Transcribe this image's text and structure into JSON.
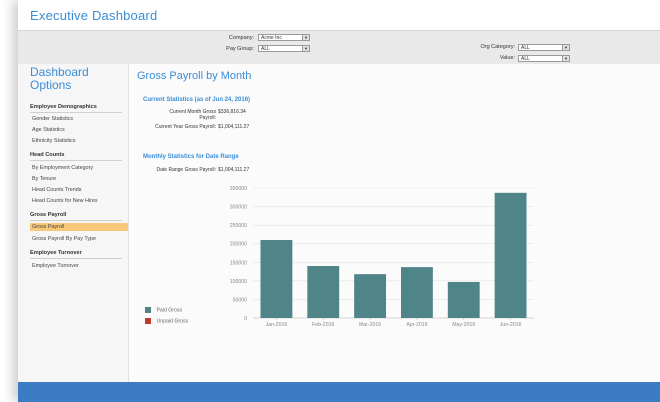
{
  "app": {
    "title": "Executive Dashboard"
  },
  "filters": {
    "company_label": "Company:",
    "company_value": "Acme Inc",
    "pay_group_label": "Pay Group:",
    "pay_group_value": "ALL",
    "org_category_label": "Org Category:",
    "org_category_value": "ALL",
    "value_label": "Value:",
    "value_value": "ALL"
  },
  "sidebar": {
    "title_line1": "Dashboard",
    "title_line2": "Options",
    "groups": [
      {
        "heading": "Employee Demographics",
        "items": [
          "Gender Statistics",
          "Age Statistics",
          "Ethnicity Statistics"
        ]
      },
      {
        "heading": "Head Counts",
        "items": [
          "By Employment Category",
          "By Tenure",
          "Head Counts Trends",
          "Head Counts for New Hires"
        ]
      },
      {
        "heading": "Gross Payroll",
        "items": [
          "Gross Payroll",
          "Gross Payroll By Pay Type"
        ]
      },
      {
        "heading": "Employee Turnover",
        "items": [
          "Employee Turnover"
        ]
      }
    ],
    "active_item": "Gross Payroll"
  },
  "main": {
    "title": "Gross Payroll by Month",
    "current_stats_title": "Current Statistics (as of Jun 24, 2016)",
    "current_month_label_1": "Current Month Gross",
    "current_month_label_2": "Payroll:",
    "current_month_value": "$336,816.34",
    "current_year_label": "Current Year Gross Payroll:",
    "current_year_value": "$1,004,111.27",
    "monthly_stats_title": "Monthly Statistics for Date Range",
    "date_range_label": "Date Range Gross Payroll:",
    "date_range_value": "$1,004,111.27"
  },
  "colors": {
    "accent": "#3a8dd6",
    "bar": "#4f8489",
    "paid_gross": "#4f8489",
    "unpaid_gross": "#c0392b",
    "active_item": "#f7c877",
    "footer": "#3b7cc4"
  },
  "chart_data": {
    "type": "bar",
    "categories": [
      "Jan-2016",
      "Feb-2016",
      "Mar-2016",
      "Apr-2016",
      "May-2016",
      "Jun-2016"
    ],
    "series": [
      {
        "name": "Paid Gross",
        "values": [
          210000,
          140000,
          118000,
          137000,
          97000,
          337000
        ]
      },
      {
        "name": "Unpaid Gross",
        "values": [
          0,
          0,
          0,
          0,
          0,
          0
        ]
      }
    ],
    "y_ticks": [
      "0",
      "50000",
      "100000",
      "150000",
      "200000",
      "250000",
      "300000",
      "350000"
    ],
    "ylim": [
      0,
      350000
    ],
    "grid": true,
    "legend_position": "left"
  }
}
